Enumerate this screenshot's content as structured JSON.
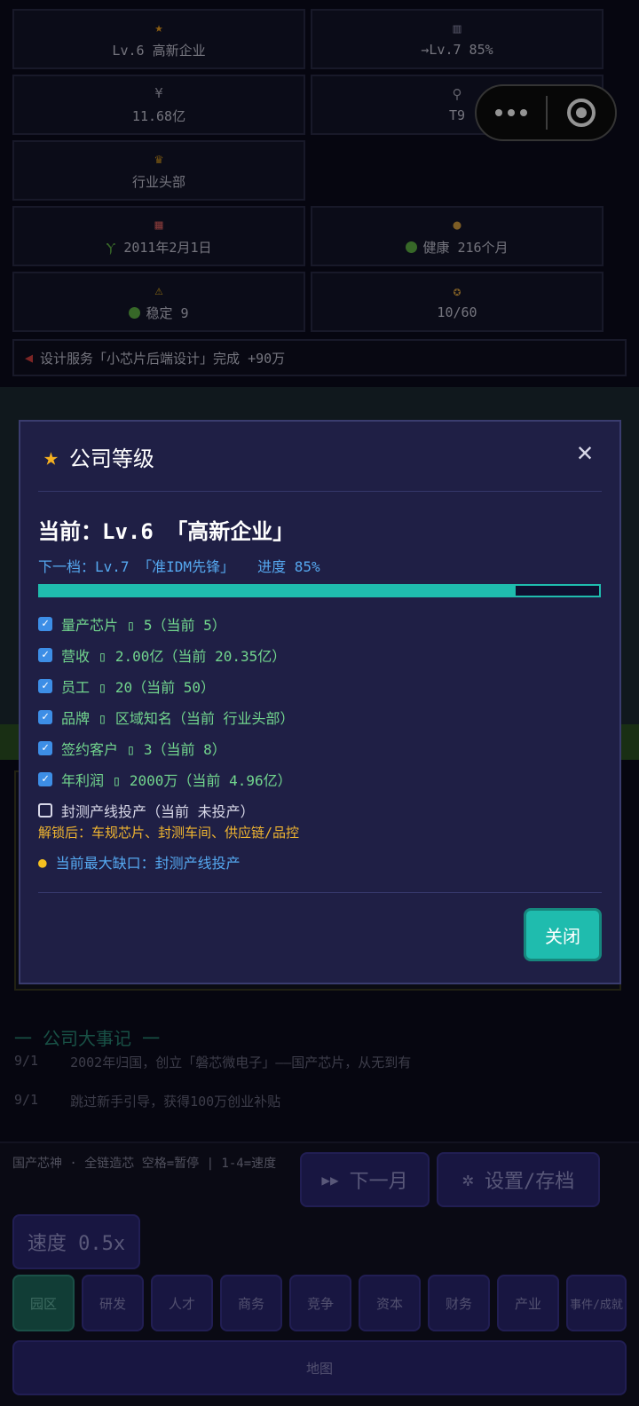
{
  "stats": {
    "level": "Lv.6 高新企业",
    "next_level": "→Lv.7 85%",
    "cash": "11.68亿",
    "tech": "T9",
    "rank": "行业头部",
    "date": "2011年2月1日",
    "finance": "健康 216个月",
    "risk": "稳定 9",
    "medals": "10/60",
    "icons": {
      "level": "star-icon",
      "next_level": "bar-chart-icon",
      "cash": "yen-icon",
      "tech": "microscope-icon",
      "rank": "trophy-icon",
      "date": "calendar-icon",
      "date_prefix": "sprout-icon",
      "finance": "money-bag-icon",
      "risk": "warning-icon",
      "medals": "medal-icon"
    }
  },
  "news": "设计服务「小芯片后端设计」完成 +90万",
  "chronicle": {
    "title": "一  公司大事记  一",
    "rows": [
      {
        "date": "9/1",
        "text": "2002年归国，创立「磐芯微电子」——国产芯片，从无到有"
      },
      {
        "date": "9/1",
        "text": "跳过新手引导，获得100万创业补贴"
      }
    ]
  },
  "bottom": {
    "note": "国产芯神 · 全链造芯 空格=暂停 | 1-4=速度",
    "next_month": "下一月",
    "settings": "设置/存档",
    "speed": "速度 0.5x",
    "tabs": [
      "园区",
      "研发",
      "人才",
      "商务",
      "竞争",
      "资本",
      "财务",
      "产业",
      "事件/成就"
    ],
    "map": "地图"
  },
  "modal": {
    "title": "公司等级",
    "current": "当前：Lv.6 「高新企业」",
    "next": "下一档：Lv.7 「准IDM先锋」",
    "progress_label": "进度 85%",
    "progress": 0.85,
    "requirements": [
      {
        "text": "量产芯片 ▯  5（当前 5）",
        "done": true
      },
      {
        "text": "营收 ▯  2.00亿（当前 20.35亿）",
        "done": true
      },
      {
        "text": "员工 ▯  20（当前 50）",
        "done": true
      },
      {
        "text": "品牌 ▯  区域知名（当前 行业头部）",
        "done": true
      },
      {
        "text": "签约客户 ▯  3（当前 8）",
        "done": true
      },
      {
        "text": "年利润 ▯  2000万（当前 4.96亿）",
        "done": true
      },
      {
        "text": "封测产线投产（当前 未投产）",
        "done": false
      }
    ],
    "unlock": "解锁后：车规芯片、封测车间、供应链/品控",
    "tip": "当前最大缺口：封测产线投产",
    "close_button": "关闭"
  }
}
